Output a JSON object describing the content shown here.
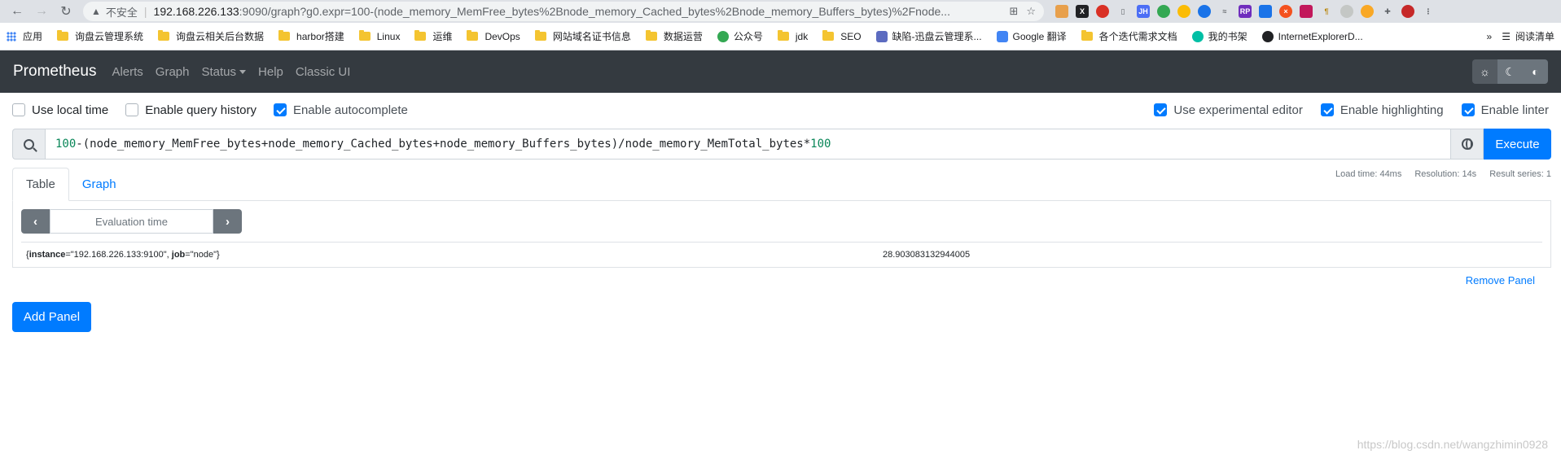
{
  "browser": {
    "address": {
      "insecure_label": "不安全",
      "host": "192.168.226.133",
      "rest": ":9090/graph?g0.expr=100-(node_memory_MemFree_bytes%2Bnode_memory_Cached_bytes%2Bnode_memory_Buffers_bytes)%2Fnode..."
    },
    "bookmarks": [
      "应用",
      "询盘云管理系统",
      "询盘云相关后台数据",
      "harbor搭建",
      "Linux",
      "运维",
      "DevOps",
      "网站域名证书信息",
      "数据运营",
      "公众号",
      "jdk",
      "SEO",
      "缺陷-迅盘云管理系...",
      "Google 翻译",
      "各个迭代需求文档",
      "我的书架",
      "InternetExplorerD..."
    ],
    "reading_list": "阅读清单",
    "overflow": "»"
  },
  "navbar": {
    "brand": "Prometheus",
    "links": [
      "Alerts",
      "Graph",
      "Status",
      "Help",
      "Classic UI"
    ]
  },
  "options": {
    "use_local_time": "Use local time",
    "enable_query_history": "Enable query history",
    "enable_autocomplete": "Enable autocomplete",
    "use_experimental_editor": "Use experimental editor",
    "enable_highlighting": "Enable highlighting",
    "enable_linter": "Enable linter"
  },
  "expression": {
    "num_prefix": "100",
    "middle": "-(node_memory_MemFree_bytes+node_memory_Cached_bytes+node_memory_Buffers_bytes)/node_memory_MemTotal_bytes*",
    "num_suffix": "100"
  },
  "execute_label": "Execute",
  "panel": {
    "tabs": [
      "Table",
      "Graph"
    ],
    "stats": {
      "load_time": "Load time: 44ms",
      "resolution": "Resolution: 14s",
      "result_series": "Result series: 1"
    },
    "eval_placeholder": "Evaluation time",
    "result": {
      "open": "{",
      "instance_key": "instance",
      "instance_val": "=\"192.168.226.133:9100\", ",
      "job_key": "job",
      "job_val": "=\"node\"}",
      "value": "28.903083132944005"
    },
    "remove_label": "Remove Panel"
  },
  "add_panel_label": "Add Panel",
  "watermark": "https://blog.csdn.net/wangzhimin0928"
}
